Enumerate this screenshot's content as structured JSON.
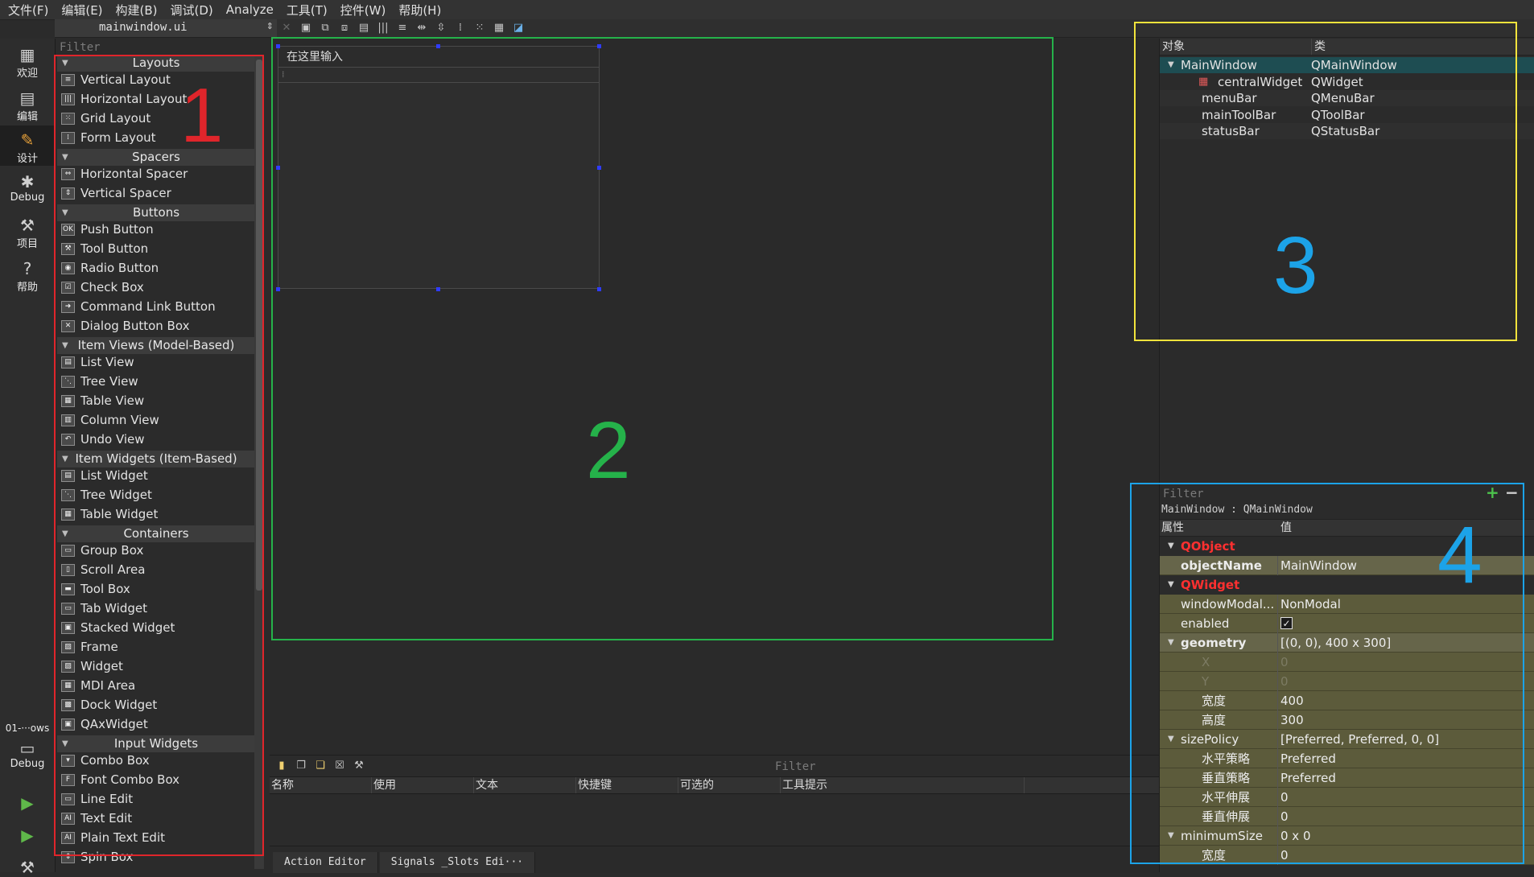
{
  "menu": [
    "文件(F)",
    "编辑(E)",
    "构建(B)",
    "调试(D)",
    "Analyze",
    "工具(T)",
    "控件(W)",
    "帮助(H)"
  ],
  "file_tab": "mainwindow.ui",
  "modes": [
    {
      "label": "欢迎",
      "icon": "grid-icon"
    },
    {
      "label": "编辑",
      "icon": "document-icon"
    },
    {
      "label": "设计",
      "icon": "pencil-icon"
    },
    {
      "label": "Debug",
      "icon": "bug-icon"
    },
    {
      "label": "项目",
      "icon": "wrench-icon"
    },
    {
      "label": "帮助",
      "icon": "help-icon"
    }
  ],
  "kit_label": "01-···ows",
  "kit_debug_label": "Debug",
  "widget_box": {
    "filter_placeholder": "Filter",
    "categories": [
      {
        "name": "Layouts",
        "items": [
          "Vertical Layout",
          "Horizontal Layout",
          "Grid Layout",
          "Form Layout"
        ]
      },
      {
        "name": "Spacers",
        "items": [
          "Horizontal Spacer",
          "Vertical Spacer"
        ]
      },
      {
        "name": "Buttons",
        "items": [
          "Push Button",
          "Tool Button",
          "Radio Button",
          "Check Box",
          "Command Link Button",
          "Dialog Button Box"
        ]
      },
      {
        "name": "Item Views (Model-Based)",
        "items": [
          "List View",
          "Tree View",
          "Table View",
          "Column View",
          "Undo View"
        ]
      },
      {
        "name": "Item Widgets (Item-Based)",
        "items": [
          "List Widget",
          "Tree Widget",
          "Table Widget"
        ]
      },
      {
        "name": "Containers",
        "items": [
          "Group Box",
          "Scroll Area",
          "Tool Box",
          "Tab Widget",
          "Stacked Widget",
          "Frame",
          "Widget",
          "MDI Area",
          "Dock Widget",
          "QAxWidget"
        ]
      },
      {
        "name": "Input Widgets",
        "items": [
          "Combo Box",
          "Font Combo Box",
          "Line Edit",
          "Text Edit",
          "Plain Text Edit",
          "Spin Box"
        ]
      }
    ]
  },
  "form": {
    "menu_placeholder": "在这里输入"
  },
  "action_editor": {
    "filter_placeholder": "Filter",
    "columns": [
      "名称",
      "使用",
      "文本",
      "快捷键",
      "可选的",
      "工具提示"
    ],
    "tabs": [
      "Action Editor",
      "Signals _Slots Edi···"
    ]
  },
  "object_inspector": {
    "columns": [
      "对象",
      "类"
    ],
    "rows": [
      {
        "object": "MainWindow",
        "class": "QMainWindow",
        "level": 0,
        "expanded": true,
        "selected": true
      },
      {
        "object": "centralWidget",
        "class": "QWidget",
        "level": 1,
        "icon": "layout-broken-icon"
      },
      {
        "object": "menuBar",
        "class": "QMenuBar",
        "level": 1
      },
      {
        "object": "mainToolBar",
        "class": "QToolBar",
        "level": 1
      },
      {
        "object": "statusBar",
        "class": "QStatusBar",
        "level": 1
      }
    ]
  },
  "property_editor": {
    "filter_placeholder": "Filter",
    "context": "MainWindow : QMainWindow",
    "columns": [
      "属性",
      "值"
    ],
    "rows": [
      {
        "type": "category",
        "name": "QObject"
      },
      {
        "type": "prop",
        "name": "objectName",
        "value": "MainWindow",
        "bold": true,
        "indent": 1
      },
      {
        "type": "category",
        "name": "QWidget"
      },
      {
        "type": "prop",
        "name": "windowModal...",
        "value": "NonModal",
        "indent": 1
      },
      {
        "type": "prop",
        "name": "enabled",
        "value": "✓",
        "indent": 1,
        "checkbox": true
      },
      {
        "type": "prop",
        "name": "geometry",
        "value": "[(0, 0), 400 x 300]",
        "bold": true,
        "indent": 1,
        "expanded": true
      },
      {
        "type": "prop",
        "name": "X",
        "value": "0",
        "indent": 2,
        "disabled": true
      },
      {
        "type": "prop",
        "name": "Y",
        "value": "0",
        "indent": 2,
        "disabled": true
      },
      {
        "type": "prop",
        "name": "宽度",
        "value": "400",
        "indent": 2
      },
      {
        "type": "prop",
        "name": "高度",
        "value": "300",
        "indent": 2
      },
      {
        "type": "prop",
        "name": "sizePolicy",
        "value": "[Preferred, Preferred, 0, 0]",
        "indent": 1,
        "expanded": true
      },
      {
        "type": "prop",
        "name": "水平策略",
        "value": "Preferred",
        "indent": 2
      },
      {
        "type": "prop",
        "name": "垂直策略",
        "value": "Preferred",
        "indent": 2
      },
      {
        "type": "prop",
        "name": "水平伸展",
        "value": "0",
        "indent": 2
      },
      {
        "type": "prop",
        "name": "垂直伸展",
        "value": "0",
        "indent": 2
      },
      {
        "type": "prop",
        "name": "minimumSize",
        "value": "0 x 0",
        "indent": 1,
        "expanded": true
      },
      {
        "type": "prop",
        "name": "宽度",
        "value": "0",
        "indent": 2
      }
    ]
  },
  "annotations": [
    {
      "label": "1",
      "color": "#e0252b"
    },
    {
      "label": "2",
      "color": "#25b24a"
    },
    {
      "label": "3",
      "color": "#1ca3e8"
    },
    {
      "label": "4",
      "color": "#1ca3e8"
    }
  ],
  "annotation_box_colors": {
    "box1": "#e0252b",
    "box2": "#25b24a",
    "box3": "#f2e33c",
    "box4": "#1ca3e8"
  }
}
